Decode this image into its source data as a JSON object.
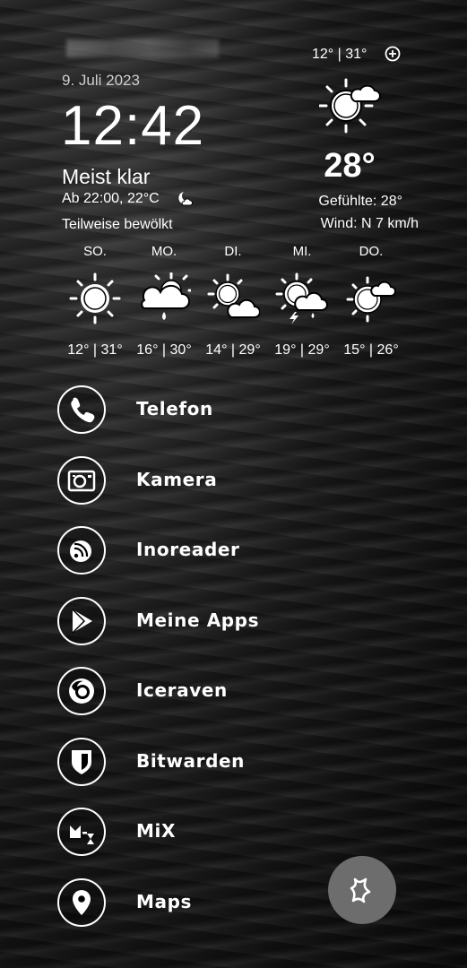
{
  "widget": {
    "date": "9. Juli 2023",
    "time": "12:42",
    "condition": "Meist klar",
    "evening": "Ab 22:00, 22°C",
    "later": "Teilweise bewölkt",
    "today_range": "12° | 31°",
    "current_temp": "28°",
    "feels_like": "Gefühlte: 28°",
    "wind": "Wind: N 7 km/h",
    "icon": "sun-cloud-icon"
  },
  "forecast": [
    {
      "day": "SO.",
      "range": "12° | 31°",
      "icon": "sun-icon"
    },
    {
      "day": "MO.",
      "range": "16° | 30°",
      "icon": "sun-cloud-rain-icon"
    },
    {
      "day": "DI.",
      "range": "14° | 29°",
      "icon": "sun-cloud-icon"
    },
    {
      "day": "MI.",
      "range": "19° | 29°",
      "icon": "sun-thunderstorm-icon"
    },
    {
      "day": "DO.",
      "range": "15° | 26°",
      "icon": "sun-cloud-icon"
    }
  ],
  "apps": [
    {
      "label": "Telefon",
      "icon": "phone-icon"
    },
    {
      "label": "Kamera",
      "icon": "camera-icon"
    },
    {
      "label": "Inoreader",
      "icon": "rss-icon"
    },
    {
      "label": "Meine Apps",
      "icon": "play-store-icon"
    },
    {
      "label": "Iceraven",
      "icon": "firefox-icon"
    },
    {
      "label": "Bitwarden",
      "icon": "shield-icon"
    },
    {
      "label": "MiX",
      "icon": "mix-icon"
    },
    {
      "label": "Maps",
      "icon": "map-pin-icon"
    }
  ],
  "colors": {
    "text": "#ffffff",
    "fab": "#6d6d6d"
  }
}
